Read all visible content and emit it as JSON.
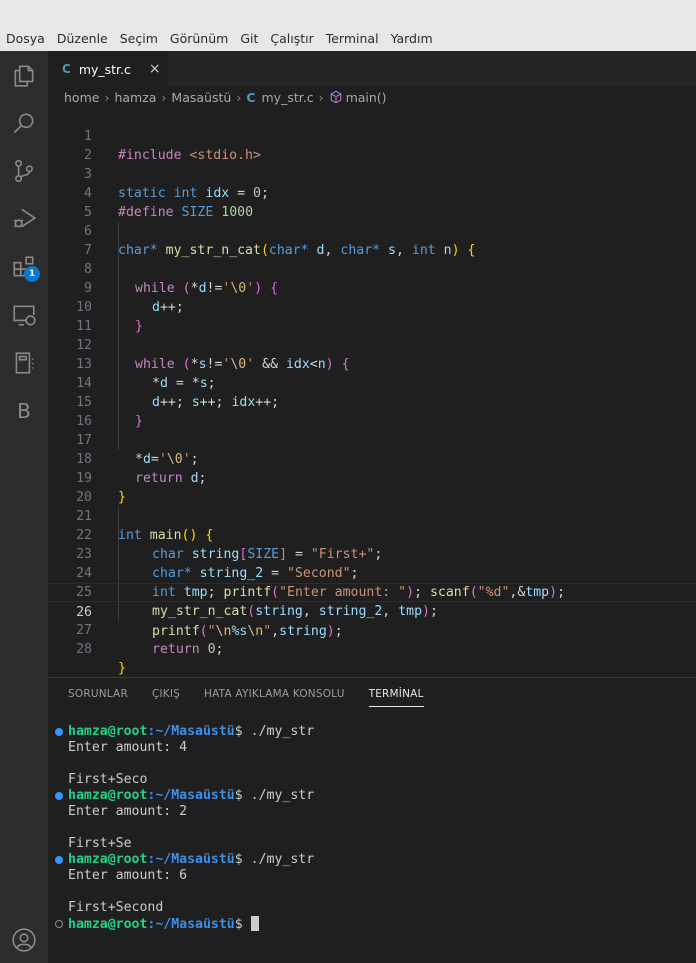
{
  "menu": [
    "Dosya",
    "Düzenle",
    "Seçim",
    "Görünüm",
    "Git",
    "Çalıştır",
    "Terminal",
    "Yardım"
  ],
  "activity_bar": {
    "icons": [
      "explorer-icon",
      "search-icon",
      "source-control-icon",
      "run-debug-icon",
      "extensions-icon",
      "remote-explorer-icon",
      "notebook-icon",
      "b-extension-icon"
    ],
    "extensions_badge": "1",
    "b_label": "B",
    "account_icon": "account-icon"
  },
  "tab": {
    "icon": "C",
    "label": "my_str.c",
    "close": "×"
  },
  "breadcrumb": {
    "parts": [
      "home",
      "hamza",
      "Masaüstü"
    ],
    "file_icon": "C",
    "file": "my_str.c",
    "symbol": "main()",
    "separator": "›"
  },
  "editor": {
    "current_line": 26,
    "lines": [
      {
        "n": "1"
      },
      {
        "n": "2"
      },
      {
        "n": "3"
      },
      {
        "n": "4"
      },
      {
        "n": "5"
      },
      {
        "n": "6"
      },
      {
        "n": "7"
      },
      {
        "n": "8"
      },
      {
        "n": "9"
      },
      {
        "n": "10"
      },
      {
        "n": "11"
      },
      {
        "n": "12"
      },
      {
        "n": "13"
      },
      {
        "n": "14"
      },
      {
        "n": "15"
      },
      {
        "n": "16"
      },
      {
        "n": "17"
      },
      {
        "n": "18"
      },
      {
        "n": "19"
      },
      {
        "n": "20"
      },
      {
        "n": "21"
      },
      {
        "n": "22"
      },
      {
        "n": "23"
      },
      {
        "n": "24"
      },
      {
        "n": "25"
      },
      {
        "n": "26"
      },
      {
        "n": "27"
      },
      {
        "n": "28"
      }
    ],
    "tokens": {
      "l1": [
        "#include",
        " ",
        "<stdio.h>"
      ],
      "l3": [
        "static",
        " ",
        "int",
        " ",
        "idx",
        " = ",
        "0",
        ";"
      ],
      "l4": [
        "#define",
        " ",
        "SIZE",
        " ",
        "1000"
      ],
      "l6": [
        "char",
        "* ",
        "my_str_n_cat",
        "(",
        "char",
        "* ",
        "d",
        ", ",
        "char",
        "* ",
        "s",
        ", ",
        "int",
        " ",
        "n",
        ")",
        " ",
        "{"
      ],
      "l8": [
        "while",
        " ",
        "(",
        "*",
        "d",
        "!=",
        "'",
        "\\0",
        "'",
        ")",
        " ",
        "{"
      ],
      "l9": [
        "d",
        "++;"
      ],
      "l10": [
        "}"
      ],
      "l12": [
        "while",
        " ",
        "(",
        "*",
        "s",
        "!=",
        "'",
        "\\0",
        "'",
        " && ",
        "idx",
        "<",
        "n",
        ")",
        " ",
        "{"
      ],
      "l13": [
        "*",
        "d",
        " = ",
        "*",
        "s",
        ";"
      ],
      "l14": [
        "d",
        "++; ",
        "s",
        "++; ",
        "idx",
        "++;"
      ],
      "l15": [
        "}"
      ],
      "l17": [
        "*",
        "d",
        "=",
        "'",
        "\\0",
        "'",
        ";"
      ],
      "l18": [
        "return",
        " ",
        "d",
        ";"
      ],
      "l19": [
        "}"
      ],
      "l21": [
        "int",
        " ",
        "main",
        "()",
        " ",
        "{"
      ],
      "l22": [
        "char",
        " ",
        "string",
        "[",
        "SIZE",
        "]",
        " = ",
        "\"First+\"",
        ";"
      ],
      "l23": [
        "char",
        "* ",
        "string_2",
        " = ",
        "\"Second\"",
        ";"
      ],
      "l24": [
        "int",
        " ",
        "tmp",
        "; ",
        "printf",
        "(",
        "\"Enter amount: \"",
        ")",
        "; ",
        "scanf",
        "(",
        "\"%d\"",
        ",&",
        "tmp",
        ")",
        ";"
      ],
      "l25": [
        "my_str_n_cat",
        "(",
        "string",
        ", ",
        "string_2",
        ", ",
        "tmp",
        ")",
        ";"
      ],
      "l26": [
        "printf",
        "(",
        "\"",
        "\\n",
        "%s",
        "\\n",
        "\"",
        ",",
        "string",
        ")",
        ";"
      ],
      "l27": [
        "return",
        " ",
        "0",
        ";"
      ],
      "l28": [
        "}"
      ]
    }
  },
  "panel": {
    "tabs": [
      "SORUNLAR",
      "ÇIKIŞ",
      "HATA AYIKLAMA KONSOLU",
      "TERMİNAL"
    ],
    "active_tab": "TERMİNAL"
  },
  "terminal": {
    "user_host": "hamza@root",
    "path": ":~/Masaüstü",
    "dollar": "$",
    "runs": [
      {
        "cmd": " ./my_str",
        "prompt": "Enter amount: 4",
        "output": "First+Seco"
      },
      {
        "cmd": " ./my_str",
        "prompt": "Enter amount: 2",
        "output": "First+Se"
      },
      {
        "cmd": " ./my_str",
        "prompt": "Enter amount: 6",
        "output": "First+Second"
      }
    ],
    "final_prompt_cmd": " "
  }
}
